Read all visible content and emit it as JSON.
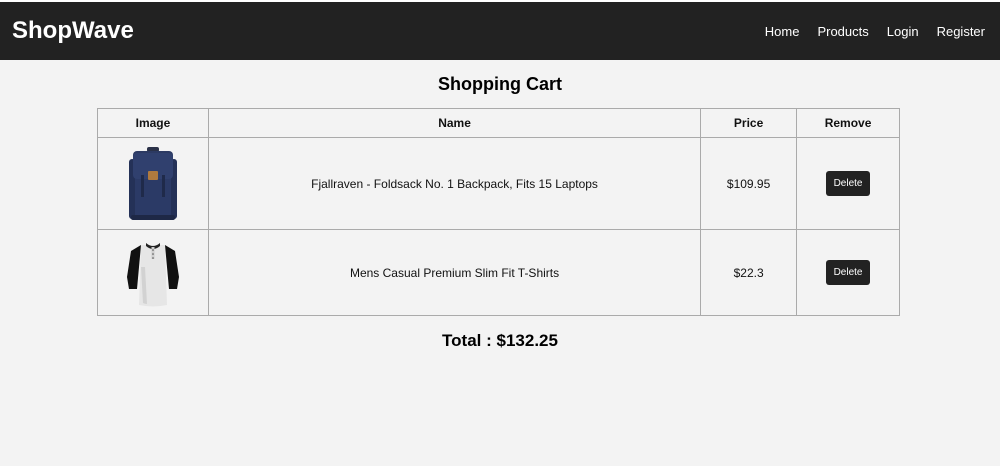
{
  "header": {
    "brand": "ShopWave",
    "nav": [
      "Home",
      "Products",
      "Login",
      "Register"
    ]
  },
  "cart": {
    "title": "Shopping Cart",
    "columns": [
      "Image",
      "Name",
      "Price",
      "Remove"
    ],
    "items": [
      {
        "name": "Fjallraven - Foldsack No. 1 Backpack, Fits 15 Laptops",
        "price": "$109.95",
        "remove_label": "Delete",
        "image_icon": "backpack-icon"
      },
      {
        "name": "Mens Casual Premium Slim Fit T-Shirts",
        "price": "$22.3",
        "remove_label": "Delete",
        "image_icon": "tshirt-icon"
      }
    ],
    "total_label": "Total : $132.25"
  },
  "colors": {
    "header_bg": "#222222",
    "page_bg": "#f3f3f3",
    "button_bg": "#222222"
  }
}
